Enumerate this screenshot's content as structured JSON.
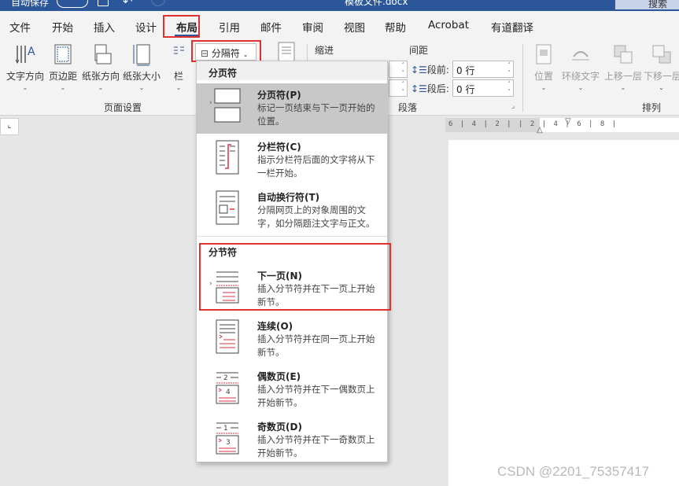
{
  "titlebar": {
    "autosave": "自动保存",
    "document_title": "模板文件.docx",
    "search_label": "搜索"
  },
  "tabs": [
    "文件",
    "开始",
    "插入",
    "设计",
    "布局",
    "引用",
    "邮件",
    "审阅",
    "视图",
    "帮助",
    "Acrobat",
    "有道翻译"
  ],
  "active_tab": "布局",
  "ribbon": {
    "page_setup": {
      "text_direction": "文字方向",
      "margins": "页边距",
      "orientation": "纸张方向",
      "size": "纸张大小",
      "columns": "栏",
      "group_label": "页面设置"
    },
    "breaks_label": "分隔符",
    "paragraph": {
      "indent_label": "缩进",
      "spacing_label": "间距",
      "before_label": "段前:",
      "after_label": "段后:",
      "before_value": "0 行",
      "after_value": "0 行",
      "group_label": "段落"
    },
    "arrange": {
      "position": "位置",
      "wrap_text": "环绕文字",
      "bring_forward": "上移一层",
      "send_backward": "下移一层",
      "group_label": "排列"
    }
  },
  "breaks_menu": {
    "page_breaks_header": "分页符",
    "section_breaks_header": "分节符",
    "items": [
      {
        "title": "分页符(P)",
        "desc": "标记一页结束与下一页开始的位置。"
      },
      {
        "title": "分栏符(C)",
        "desc": "指示分栏符后面的文字将从下一栏开始。"
      },
      {
        "title": "自动换行符(T)",
        "desc": "分隔网页上的对象周围的文字，如分隔题注文字与正文。"
      },
      {
        "title": "下一页(N)",
        "desc": "插入分节符并在下一页上开始新节。"
      },
      {
        "title": "连续(O)",
        "desc": "插入分节符并在同一页上开始新节。"
      },
      {
        "title": "偶数页(E)",
        "desc": "插入分节符并在下一偶数页上开始新节。"
      },
      {
        "title": "奇数页(D)",
        "desc": "插入分节符并在下一奇数页上开始新节。"
      }
    ]
  },
  "ruler": {
    "numbers": "6 | 4 | 2 |   | 2 | 4 | 6 | 8 |"
  },
  "watermark": "CSDN @2201_75357417",
  "colors": {
    "accent": "#2b579a",
    "highlight_box": "#e03131",
    "selected_item": "#c8c8c8"
  }
}
